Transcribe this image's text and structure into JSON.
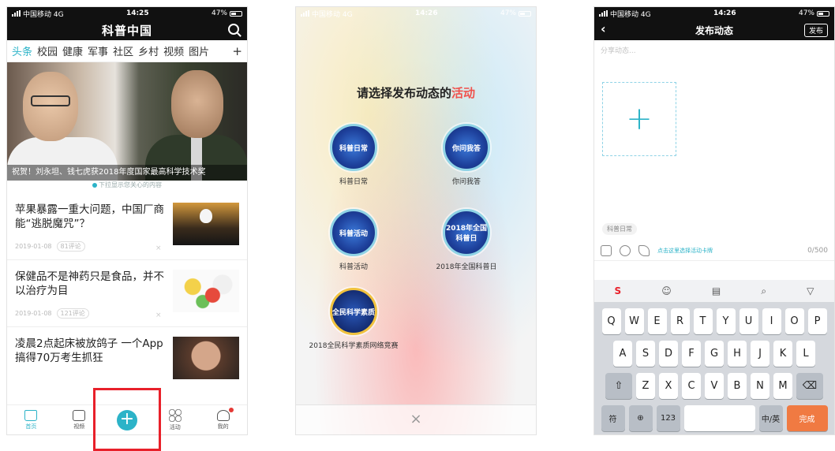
{
  "phone1": {
    "status": {
      "carrier": "中国移动 4G",
      "time": "14:25",
      "battery": "47%"
    },
    "app_title": "科普中国",
    "tabs": [
      "头条",
      "校园",
      "健康",
      "军事",
      "社区",
      "乡村",
      "视频",
      "图片"
    ],
    "hero_caption": "祝贺！刘永坦、钱七虎获2018年度国家最高科学技术奖",
    "pull_tip": "下拉显示您关心的内容",
    "news": [
      {
        "title": "苹果暴露一重大问题，中国厂商能“逃脱魔咒”？",
        "date": "2019-01-08",
        "comments": "81评论"
      },
      {
        "title": "保健品不是神药只是食品，并不以治疗为目",
        "date": "2019-01-08",
        "comments": "121评论"
      },
      {
        "title": "凌晨2点起床被放鸽子 一个App搞得70万考生抓狂",
        "date": "",
        "comments": ""
      }
    ],
    "tabbar": [
      "首页",
      "视频",
      "",
      "活动",
      "我的"
    ]
  },
  "phone2": {
    "status": {
      "carrier": "中国移动 4G",
      "time": "14:26",
      "battery": "47%"
    },
    "title_prefix": "请选择发布动态的",
    "title_highlight": "活动",
    "activities": [
      {
        "label": "科普日常",
        "badge": "科普日常"
      },
      {
        "label": "你问我答",
        "badge": "你问我答"
      },
      {
        "label": "科普活动",
        "badge": "科普活动"
      },
      {
        "label": "2018年全国科普日",
        "badge": "2018年全国科普日"
      },
      {
        "label": "2018全民科学素质网络竞赛",
        "badge": "全民科学素质"
      }
    ],
    "close": "×"
  },
  "phone3": {
    "status": {
      "carrier": "中国移动 4G",
      "time": "14:26",
      "battery": "47%"
    },
    "nav_title": "发布动态",
    "publish_label": "发布",
    "input_placeholder": "分享动态...",
    "activity_tag": "科普日常",
    "toolbar_hint": "点击这里选择活动卡牌",
    "char_count": "0/500",
    "keyboard": {
      "row1": [
        "Q",
        "W",
        "E",
        "R",
        "T",
        "Y",
        "U",
        "I",
        "O",
        "P"
      ],
      "row2": [
        "A",
        "S",
        "D",
        "F",
        "G",
        "H",
        "J",
        "K",
        "L"
      ],
      "row3": [
        "Z",
        "X",
        "C",
        "V",
        "B",
        "N",
        "M"
      ],
      "bottom": {
        "sym": "符",
        "num": "123",
        "lang": "中/英",
        "done": "完成"
      }
    }
  }
}
